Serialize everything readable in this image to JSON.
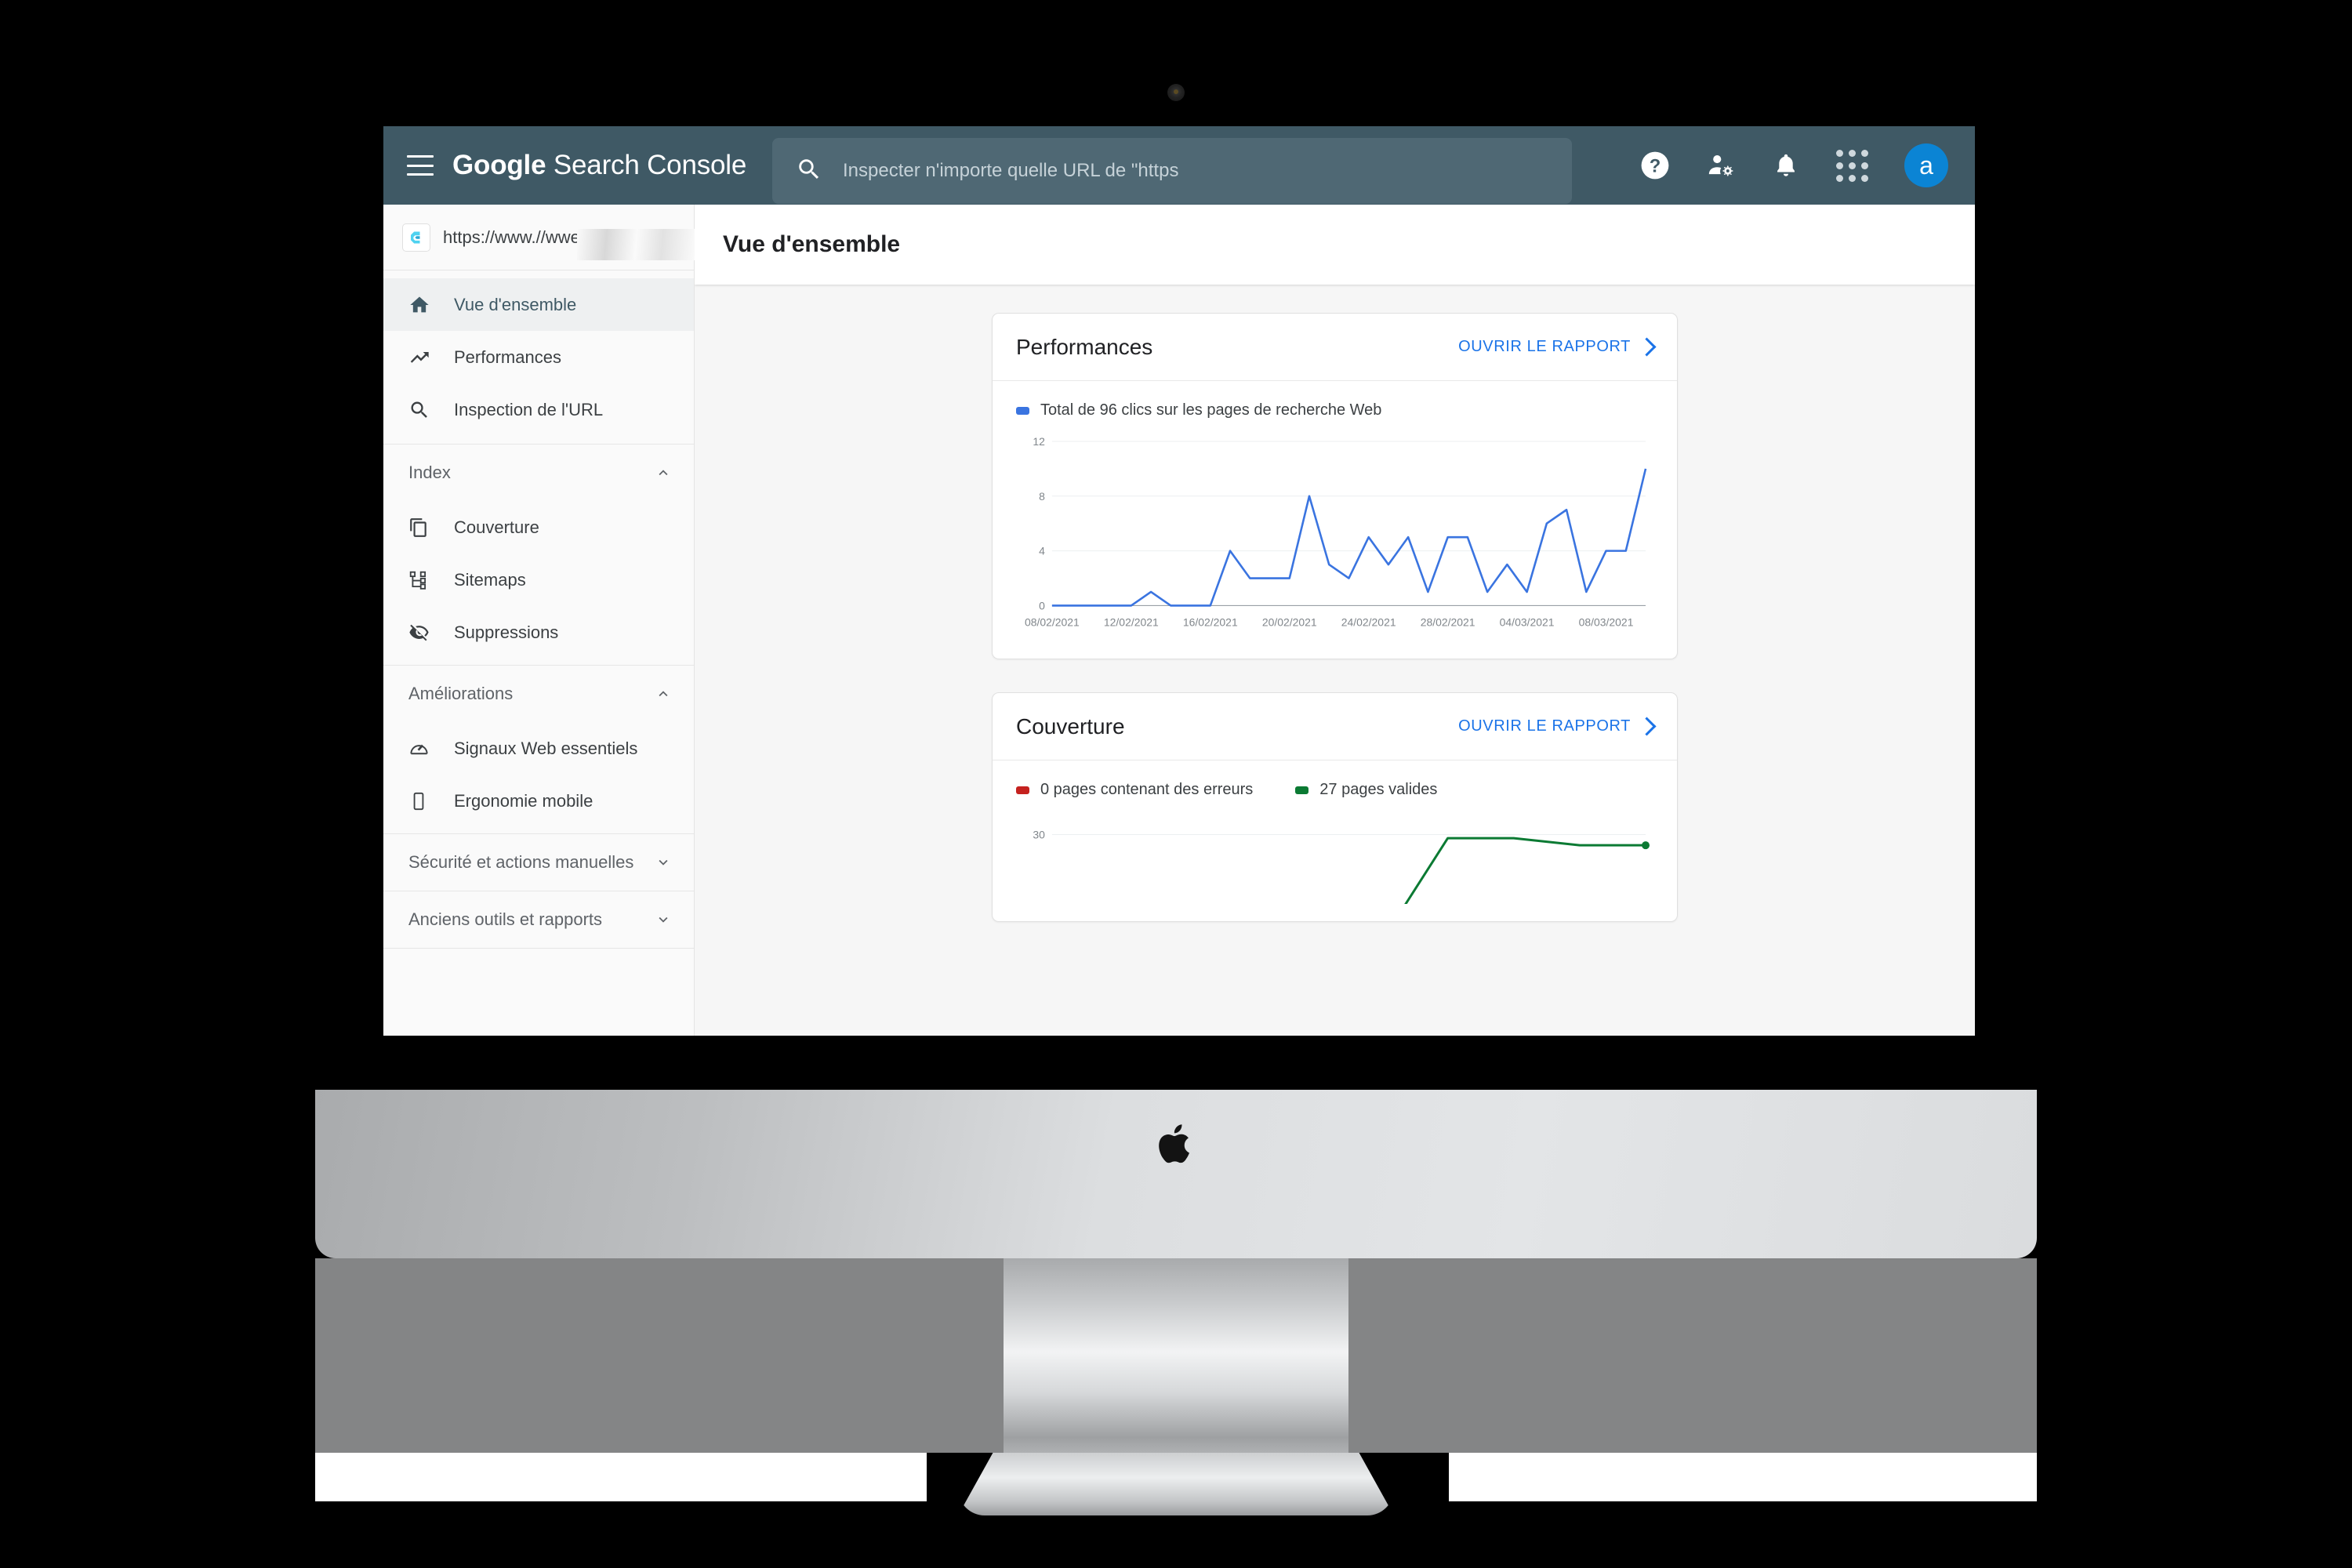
{
  "appbar": {
    "menu_label": "menu",
    "brand_bold": "Google",
    "brand_rest": "Search Console",
    "background": "#3f5965",
    "search": {
      "placeholder": "Inspecter n'importe quelle URL de \"https",
      "value": ""
    },
    "icons": {
      "help": "help-icon",
      "accounts": "account-settings-icon",
      "notifications": "bell-icon",
      "apps": "apps-grid-icon"
    },
    "avatar_letter": "a",
    "avatar_color": "#0b84d4"
  },
  "sidebar": {
    "property": {
      "url": "https://www.//wwe",
      "logo_letter": "C"
    },
    "primary_items": [
      {
        "label": "Vue d'ensemble",
        "icon": "home-icon",
        "active": true
      },
      {
        "label": "Performances",
        "icon": "trending-up-icon",
        "active": false
      },
      {
        "label": "Inspection de l'URL",
        "icon": "search-icon",
        "active": false
      }
    ],
    "sections": [
      {
        "title": "Index",
        "expanded": true,
        "items": [
          {
            "label": "Couverture",
            "icon": "pages-copy-icon"
          },
          {
            "label": "Sitemaps",
            "icon": "sitemap-icon"
          },
          {
            "label": "Suppressions",
            "icon": "eye-off-icon"
          }
        ]
      },
      {
        "title": "Améliorations",
        "expanded": true,
        "items": [
          {
            "label": "Signaux Web essentiels",
            "icon": "speedometer-icon"
          },
          {
            "label": "Ergonomie mobile",
            "icon": "mobile-icon"
          }
        ]
      },
      {
        "title": "Sécurité et actions manuelles",
        "expanded": false,
        "items": []
      },
      {
        "title": "Anciens outils et rapports",
        "expanded": false,
        "items": []
      }
    ]
  },
  "page": {
    "title": "Vue d'ensemble"
  },
  "cards": {
    "performance": {
      "title": "Performances",
      "open_report_label": "OUVRIR LE RAPPORT",
      "legend": [
        {
          "label": "Total de 96 clics sur les pages de recherche Web",
          "color": "#3a74e0"
        }
      ]
    },
    "coverage": {
      "title": "Couverture",
      "open_report_label": "OUVRIR LE RAPPORT",
      "legend": [
        {
          "label": "0 pages contenant des erreurs",
          "color": "#c5221f"
        },
        {
          "label": "27 pages valides",
          "color": "#0b7a33"
        }
      ]
    }
  },
  "chart_data": [
    {
      "type": "line",
      "title": "Performances",
      "xlabel": "",
      "ylabel": "",
      "ylim": [
        0,
        12
      ],
      "yticks": [
        0,
        4,
        8,
        12
      ],
      "grid": true,
      "legend_position": "top-left",
      "tick_labels": [
        "08/02/2021",
        "12/02/2021",
        "16/02/2021",
        "20/02/2021",
        "24/02/2021",
        "28/02/2021",
        "04/03/2021",
        "08/03/2021"
      ],
      "x": [
        "08/02/2021",
        "09/02/2021",
        "10/02/2021",
        "11/02/2021",
        "12/02/2021",
        "13/02/2021",
        "14/02/2021",
        "15/02/2021",
        "16/02/2021",
        "17/02/2021",
        "18/02/2021",
        "19/02/2021",
        "20/02/2021",
        "21/02/2021",
        "22/02/2021",
        "23/02/2021",
        "24/02/2021",
        "25/02/2021",
        "26/02/2021",
        "27/02/2021",
        "28/02/2021",
        "01/03/2021",
        "02/03/2021",
        "03/03/2021",
        "04/03/2021",
        "05/03/2021",
        "06/03/2021",
        "07/03/2021",
        "08/03/2021",
        "09/03/2021",
        "10/03/2021"
      ],
      "series": [
        {
          "name": "Total de 96 clics sur les pages de recherche Web",
          "color": "#3a74e0",
          "values": [
            0,
            0,
            0,
            0,
            0,
            1,
            0,
            0,
            0,
            4,
            2,
            2,
            2,
            8,
            3,
            2,
            5,
            3,
            5,
            1,
            5,
            5,
            1,
            3,
            1,
            6,
            7,
            1,
            4,
            4,
            10
          ]
        }
      ]
    },
    {
      "type": "line",
      "title": "Couverture",
      "ylim": [
        0,
        30
      ],
      "yticks": [
        30
      ],
      "grid": true,
      "legend_position": "top-left",
      "series": [
        {
          "name": "0 pages contenant des erreurs",
          "color": "#c5221f",
          "values": [
            0,
            0,
            0,
            0,
            0,
            0,
            0,
            0
          ]
        },
        {
          "name": "27 pages valides",
          "color": "#0b7a33",
          "values": [
            0,
            0,
            0,
            0,
            0,
            0,
            29,
            29,
            27,
            27
          ]
        }
      ]
    }
  ]
}
